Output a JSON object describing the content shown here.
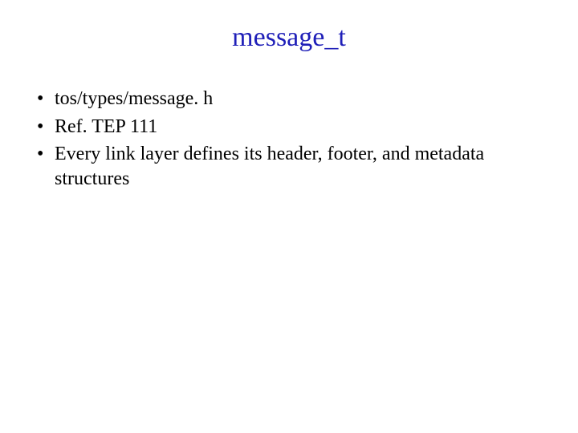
{
  "slide": {
    "title": "message_t",
    "bullets": [
      "tos/types/message. h",
      "Ref. TEP 111",
      "Every link layer defines its header, footer, and metadata structures"
    ]
  }
}
